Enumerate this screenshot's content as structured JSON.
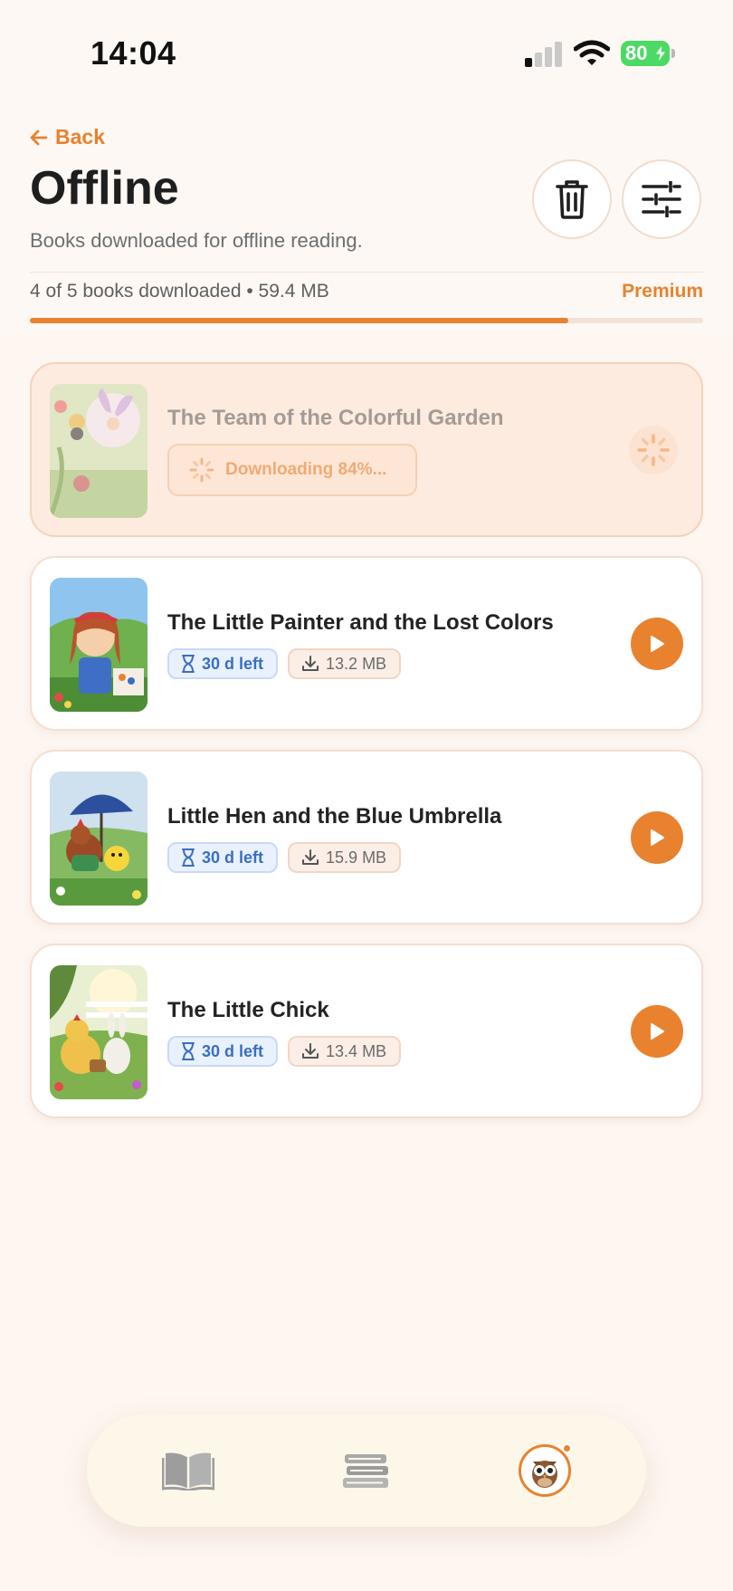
{
  "status_bar": {
    "time": "14:04",
    "battery": "80"
  },
  "header": {
    "back_label": "Back",
    "title": "Offline",
    "subtitle": "Books downloaded for offline reading."
  },
  "storage": {
    "summary": "4 of 5 books downloaded • 59.4 MB",
    "plan_label": "Premium",
    "progress_percent": 80
  },
  "downloading": {
    "title": "The Team of the Colorful Garden",
    "status": "Downloading 84%...",
    "progress_percent": 84
  },
  "books": [
    {
      "title": "The Little Painter and the Lost Colors",
      "expiry": "30 d left",
      "size": "13.2 MB"
    },
    {
      "title": "Little Hen and the Blue Umbrella",
      "expiry": "30 d left",
      "size": "15.9 MB"
    },
    {
      "title": "The Little Chick",
      "expiry": "30 d left",
      "size": "13.4 MB"
    }
  ],
  "icons": {
    "back": "arrow-left-icon",
    "delete": "trash-icon",
    "filter": "sliders-icon",
    "expiry": "hourglass-icon",
    "size": "download-icon",
    "play": "play-icon",
    "nav": [
      "book-open-icon",
      "books-stack-icon",
      "owl-avatar-icon"
    ]
  },
  "colors": {
    "accent": "#e8822f",
    "background": "#fdf6f1",
    "expiry_tag": "#3a6ec2"
  }
}
